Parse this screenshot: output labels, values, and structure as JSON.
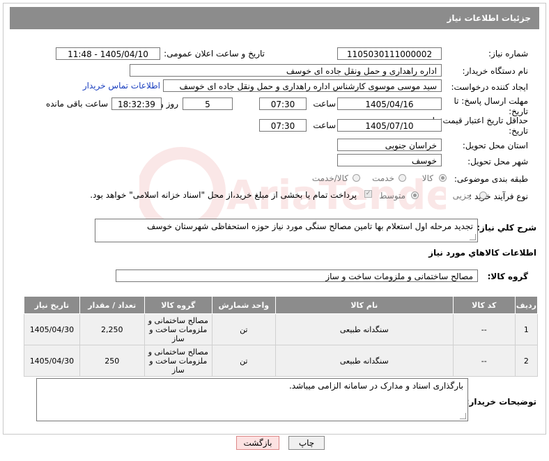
{
  "header": {
    "title": "جزئیات اطلاعات نیاز"
  },
  "fields": {
    "need_number_label": "شماره نیاز:",
    "need_number": "1105030111000002",
    "announce_label": "تاریخ و ساعت اعلان عمومی:",
    "announce_value": "1405/04/10 - 11:48",
    "buyer_org_label": "نام دستگاه خریدار:",
    "buyer_org": "اداره راهداری و حمل ونقل جاده ای خوسف",
    "creator_label": "ایجاد کننده درخواست:",
    "creator": "سید موسی موسوی کارشناس اداره راهداری و حمل ونقل جاده ای خوسف",
    "contact_link": "اطلاعات تماس خریدار",
    "deadline_label": "مهلت ارسال پاسخ: تا تاریخ:",
    "deadline_date": "1405/04/16",
    "time_label": "ساعت",
    "deadline_time": "07:30",
    "days_value": "5",
    "days_label": "روز و",
    "remaining_time": "18:32:39",
    "remaining_label": "ساعت باقی مانده",
    "validity_label": "حداقل تاریخ اعتبار قیمت: تا تاریخ:",
    "validity_date": "1405/07/10",
    "validity_time": "07:30",
    "province_label": "استان محل تحویل:",
    "province": "خراسان جنوبی",
    "city_label": "شهر محل تحویل:",
    "city": "خوسف",
    "category_label": "طبقه بندی موضوعی:",
    "category_options": [
      "کالا",
      "خدمت",
      "کالا/خدمت"
    ],
    "process_label": "نوع فرآیند خرید :",
    "process_options": [
      "جزیی",
      "متوسط"
    ],
    "payment_note": "پرداخت تمام یا بخشی از مبلغ خرید،از محل \"اسناد خزانه اسلامی\" خواهد بود."
  },
  "description": {
    "label": "شرح کلي نياز:",
    "text": "تجدید مرحله اول استعلام بها  تامین مصالح سنگی مورد نیاز حوزه استحفاظی شهرستان خوسف"
  },
  "goods": {
    "section_title": "اطلاعات کالاهاي مورد نياز",
    "group_label": "گروه کالا:",
    "group_value": "مصالح ساختمانی و ملزومات ساخت و ساز",
    "columns": [
      "ردیف",
      "کد کالا",
      "نام کالا",
      "واحد شمارش",
      "گروه کالا",
      "تعداد / مقدار",
      "تاریخ نیاز"
    ],
    "rows": [
      {
        "row": "1",
        "code": "--",
        "name": "سنگدانه طبیعی",
        "unit": "تن",
        "group": "مصالح ساختمانی و ملزومات ساخت و ساز",
        "qty": "2,250",
        "date": "1405/04/30"
      },
      {
        "row": "2",
        "code": "--",
        "name": "سنگدانه طبیعی",
        "unit": "تن",
        "group": "مصالح ساختمانی و ملزومات ساخت و ساز",
        "qty": "250",
        "date": "1405/04/30"
      }
    ]
  },
  "buyer_notes": {
    "label": "توضیحات خریدار:",
    "text": "بارگذاری اسناد و مدارک در سامانه الزامی میباشد."
  },
  "buttons": {
    "print": "چاپ",
    "back": "بازگشت"
  },
  "watermark": {
    "text": "AriaTender.net"
  },
  "colors": {
    "header": "#8c8c8c",
    "link": "#1a3fbf",
    "back_button": "#fde2e2"
  }
}
